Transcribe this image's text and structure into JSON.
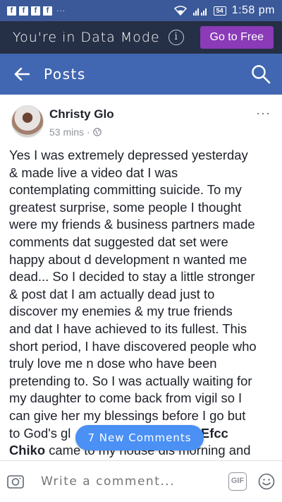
{
  "status_bar": {
    "app_icons": [
      "f",
      "f",
      "f",
      "f"
    ],
    "overflow": "···",
    "battery": "54",
    "time": "1:58 pm"
  },
  "data_mode": {
    "text": "You're in Data Mode",
    "info": "i",
    "button": "Go to Free"
  },
  "header": {
    "title": "Posts"
  },
  "post": {
    "author": "Christy Glo",
    "time": "53 mins",
    "meta_sep": "·",
    "more": "···",
    "lines": [
      "Yes I was extremely depressed yesterday",
      "& made live a video dat I was",
      "contemplating committing suicide.  To my",
      "greatest surprise, some people I thought",
      "were my friends & business partners made",
      "comments dat suggested dat set were",
      "happy about d development n wanted me",
      "dead... So I decided to stay a little stronger",
      "& post dat I am actually dead just to",
      "discover my enemies & my true friends",
      "and dat I have achieved to its fullest. This",
      "short period, I have discovered people who",
      "truly love me n dose who have been",
      "pretending to. So I was actually waiting for",
      "my daughter to come back from vigil so I",
      "can give her my blessings before I go but",
      "to God's gl"
    ],
    "line17_tail": "nd ",
    "line17_bold": "Efcc",
    "line18_bold": "Chiko",
    "line18_rest": " came to my house dis morning and"
  },
  "new_comments": "7 New Comments",
  "comment_bar": {
    "placeholder": "Write a comment...",
    "gif": "GIF"
  },
  "colors": {
    "status": "#3b5998",
    "data_bar": "#252f45",
    "header": "#4267b2",
    "go_free": "#8b3ab8",
    "pill": "#4a90f5"
  }
}
